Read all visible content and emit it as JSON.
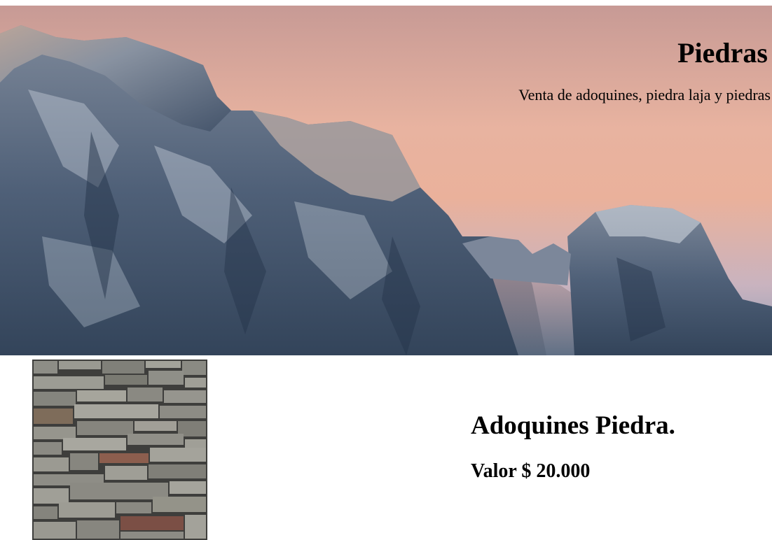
{
  "hero": {
    "title": "Piedras",
    "subtitle": "Venta de adoquines, piedra laja y piedras",
    "image": "snowy-rocky-mountain-at-sunset"
  },
  "product": {
    "image": "stacked-stone-wall",
    "name": "Adoquines Piedra.",
    "price": "Valor $ 20.000"
  },
  "colors": {
    "sky": "#e8b3a0",
    "rock": "#4d5d72",
    "text": "#000000",
    "background": "#ffffff"
  }
}
